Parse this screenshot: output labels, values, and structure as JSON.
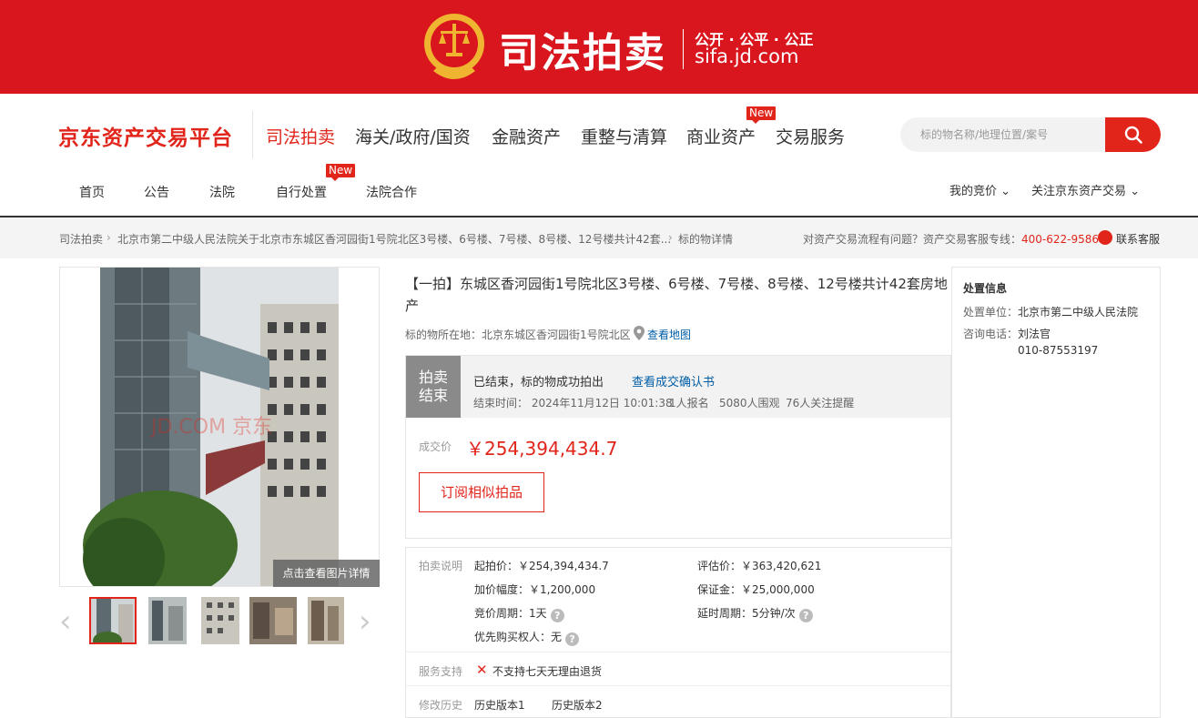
{
  "banner": {
    "title": "司法拍卖",
    "slogan": "公开 · 公平 · 公正",
    "domain": "sifa.jd.com"
  },
  "header": {
    "logo": "京东资产交易平台",
    "main_nav": [
      "司法拍卖",
      "海关/政府/国资",
      "金融资产",
      "重整与清算",
      "商业资产",
      "交易服务"
    ],
    "new_badge": "New",
    "search_placeholder": "标的物名称/地理位置/案号",
    "sub_nav": [
      "首页",
      "公告",
      "法院",
      "自行处置",
      "法院合作"
    ],
    "right_menu": [
      "我的竞价",
      "关注京东资产交易"
    ]
  },
  "breadcrumb": {
    "items": [
      "司法拍卖",
      "北京市第二中级人民法院关于北京市东城区香河园街1号院北区3号楼、6号楼、7号楼、8号楼、12号楼共计42套...",
      "标的物详情"
    ],
    "help_text": "对资产交易流程有问题？资产交易客服专线：",
    "help_phone": "400-622-9586",
    "service": "联系客服"
  },
  "gallery": {
    "caption": "点击查看图片详情",
    "watermark": "JD.COM 京东"
  },
  "item": {
    "title": "【一拍】东城区香河园街1号院北区3号楼、6号楼、7号楼、8号楼、12号楼共计42套房地产",
    "location_label": "标的物所在地：",
    "location": "北京东城区香河园街1号院北区",
    "map_link": "查看地图"
  },
  "status": {
    "tag": "拍卖结束",
    "text": "已结束，标的物成功拍出",
    "link": "查看成交确认书",
    "end_time": "结束时间：  2024年11月12日 10:01:38",
    "signups": "1人报名",
    "viewers": "5080人围观",
    "watchers": "76人关注提醒",
    "price_label": "成交价",
    "price": "￥254,394,434.7",
    "subscribe": "订阅相似拍品"
  },
  "info": {
    "label_auction": "拍卖说明",
    "start_price": "起拍价：￥254,394,434.7",
    "appraisal": "评估价：￥363,420,621",
    "increment": "加价幅度：￥1,200,000",
    "deposit": "保证金：￥25,000,000",
    "bid_period": "竞价周期：1天",
    "delay_period": "延时周期：5分钟/次",
    "priority": "优先购买权人：无",
    "label_service": "服务支持",
    "service": "不支持七天无理由退货",
    "label_history": "修改历史",
    "history": [
      "历史版本1",
      "历史版本2"
    ]
  },
  "side": {
    "title": "处置信息",
    "unit_label": "处置单位：",
    "unit": "北京市第二中级人民法院",
    "contact_label": "咨询电话：",
    "contact_name": "刘法官",
    "contact_phone": "010-87553197"
  },
  "colors": {
    "brand_red": "#d9151e",
    "accent_red": "#e1251b",
    "link_blue": "#005ea7"
  }
}
